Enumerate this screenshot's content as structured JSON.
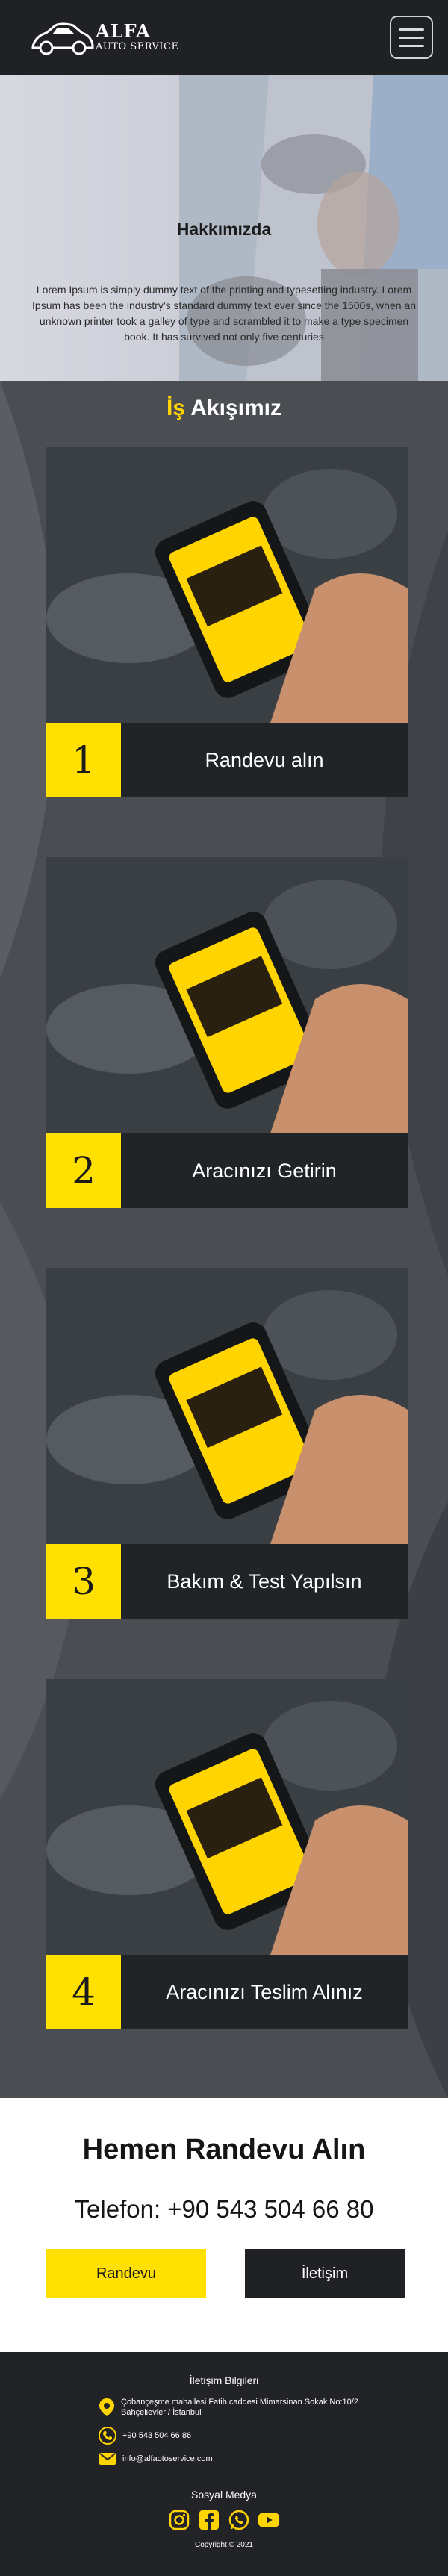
{
  "brand": {
    "name": "ALFA",
    "subtitle": "AUTO SERVICE"
  },
  "about": {
    "title": "Hakkımızda",
    "text": "Lorem Ipsum is simply dummy text of the printing and typesetting industry. Lorem Ipsum has been the industry's standard dummy text ever since the 1500s, when an unknown printer took a galley of type and scrambled it to make a type specimen book. It has survived not only five centuries"
  },
  "process": {
    "title_highlight": "İş",
    "title_rest": " Akışımız",
    "steps": [
      {
        "number": "1",
        "label": "Randevu alın"
      },
      {
        "number": "2",
        "label": "Aracınızı Getirin"
      },
      {
        "number": "3",
        "label": "Bakım & Test Yapılsın"
      },
      {
        "number": "4",
        "label": "Aracınızı Teslim Alınız"
      }
    ]
  },
  "cta": {
    "title": "Hemen Randevu Alın",
    "phone": "Telefon: +90 543 504 66 80",
    "primary_button": "Randevu",
    "secondary_button": "İletişim"
  },
  "footer": {
    "contact_title": "İletişim Bilgileri",
    "address": "Çobançeşme mahallesi Fatih caddesi Mimarsinan Sokak No:10/2 Bahçelievler / İstanbul",
    "phone": "+90 543 504 66 86",
    "email": "info@alfaotoservice.com",
    "social_title": "Sosyal Medya",
    "socials": [
      "instagram-icon",
      "facebook-icon",
      "whatsapp-icon",
      "youtube-icon"
    ],
    "copyright": "Copyright © 2021"
  },
  "colors": {
    "accent": "#ffe000",
    "dark": "#1f2124",
    "process_bg": "#4a4d52"
  }
}
